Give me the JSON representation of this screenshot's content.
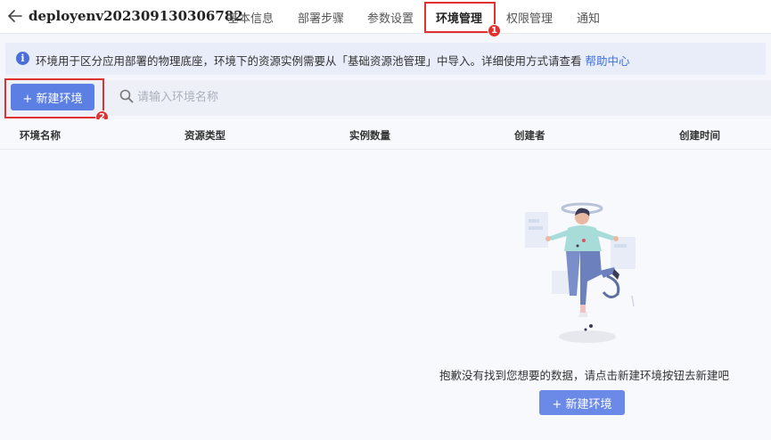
{
  "header": {
    "back_icon": "arrow-left-icon",
    "title": "deployenv202309130306782",
    "tabs": [
      {
        "label": "基本信息",
        "active": false
      },
      {
        "label": "部署步骤",
        "active": false
      },
      {
        "label": "参数设置",
        "active": false
      },
      {
        "label": "环境管理",
        "active": true
      },
      {
        "label": "权限管理",
        "active": false
      },
      {
        "label": "通知",
        "active": false
      }
    ]
  },
  "callouts": [
    {
      "number": "1"
    },
    {
      "number": "2"
    }
  ],
  "info_bar": {
    "icon": "info-icon",
    "text": "环境用于区分应用部署的物理底座，环境下的资源实例需要从「基础资源池管理」中导入。详细使用方式请查看",
    "link": "帮助中心"
  },
  "toolbar": {
    "new_button_label": "+ 新建环境",
    "search_placeholder": "请输入环境名称",
    "search_value": ""
  },
  "table": {
    "columns": [
      "环境名称",
      "资源类型",
      "实例数量",
      "创建者",
      "创建时间"
    ],
    "rows": []
  },
  "empty_state": {
    "message": "抱歉没有找到您想要的数据，请点击新建环境按钮去新建吧",
    "button_label": "+ 新建环境"
  },
  "colors": {
    "accent": "#5b7fe3",
    "callout": "#e03131",
    "link": "#3d6fe0"
  }
}
